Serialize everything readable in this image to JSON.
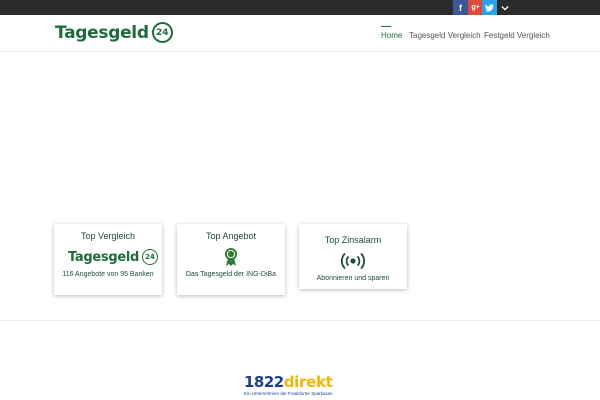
{
  "social": {
    "facebook_glyph": "f",
    "googleplus_glyph": "g+",
    "twitter_icon": "twitter-bird-icon",
    "more_icon": "chevron-down-icon"
  },
  "header": {
    "logo_text": "Tagesgeld",
    "logo_badge": "24",
    "nav": [
      {
        "label": "Home",
        "active": true
      },
      {
        "label": "Tagesgeld Vergleich",
        "active": false
      },
      {
        "label": "Festgeld Vergleich",
        "active": false
      }
    ]
  },
  "cards": [
    {
      "title": "Top Vergleich",
      "logo_text": "Tagesgeld",
      "logo_badge": "24",
      "text": "116 Angebote von 95 Banken",
      "icon": "tagesgeld24-logo"
    },
    {
      "title": "Top Angebot",
      "text": "Das Tagesgeld der ING-DiBa",
      "icon": "award-ribbon-icon"
    },
    {
      "title": "Top Zinsalarm",
      "text": "Abonnieren und sparen",
      "icon": "broadcast-signal-icon"
    }
  ],
  "sponsor": {
    "number": "1822",
    "word": "direkt",
    "tagline": "Ein Unternehmen der Frankfurter Sparkasse"
  },
  "colors": {
    "brand_green": "#1e6b3c",
    "topbar": "#2b2b2b",
    "facebook": "#3b5998",
    "googleplus": "#dd4b39",
    "twitter": "#2aa3ef",
    "sponsor_blue": "#1d3f8f",
    "sponsor_yellow": "#f2b705"
  }
}
